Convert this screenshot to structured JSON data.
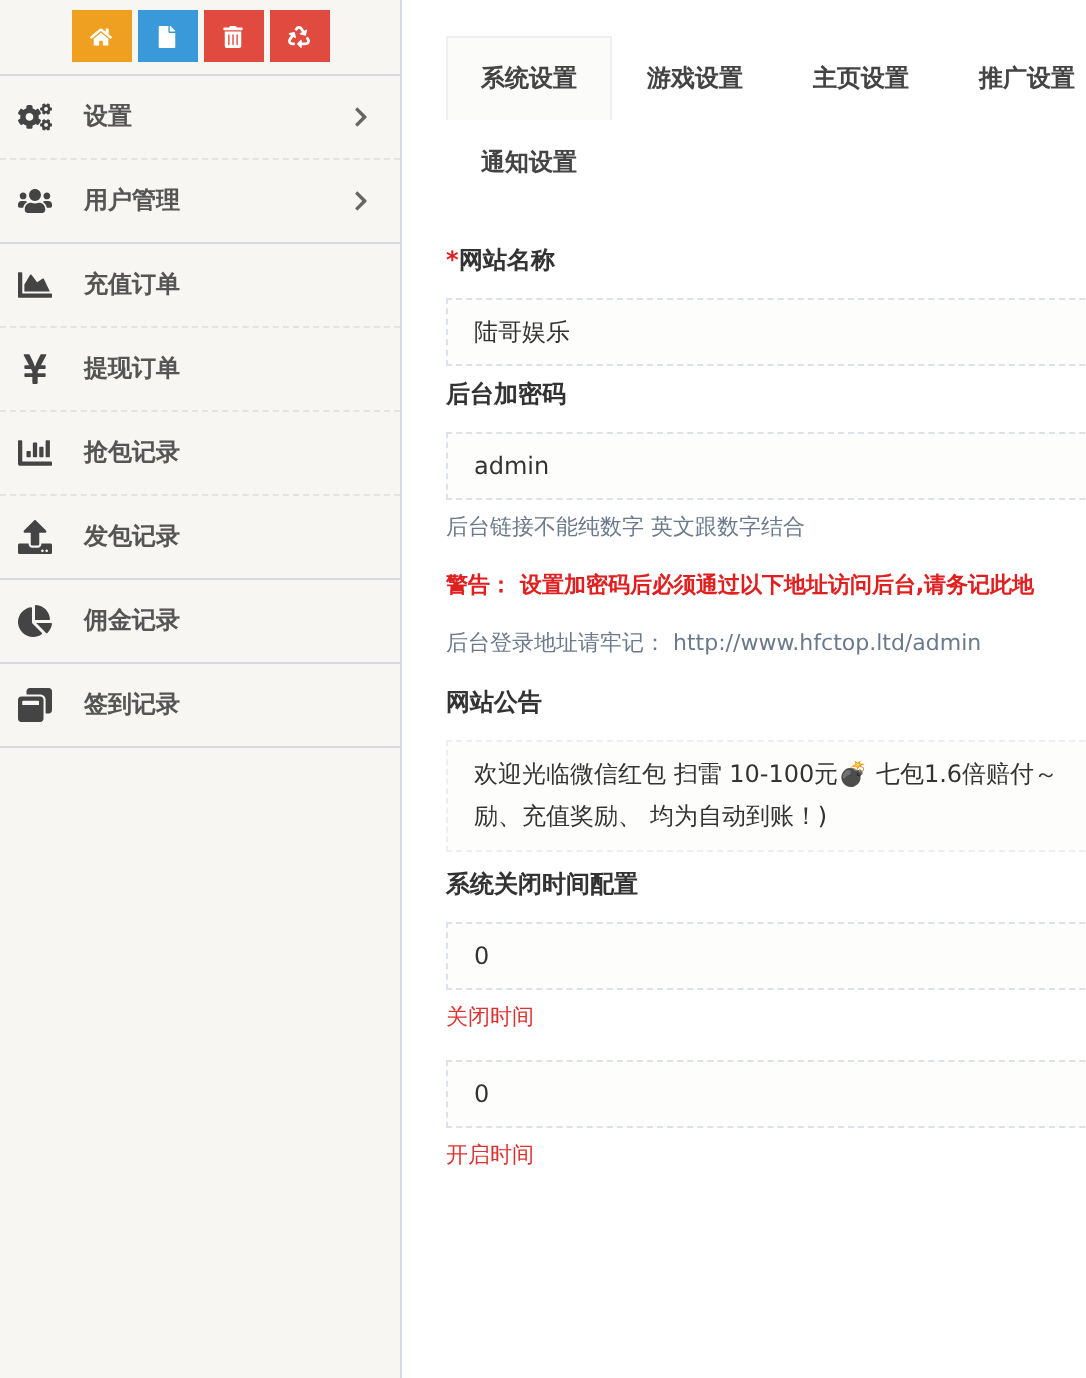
{
  "toolbar": [
    {
      "kind": "home",
      "color": "#f0a020"
    },
    {
      "kind": "file",
      "color": "#3a9ad9"
    },
    {
      "kind": "trash",
      "color": "#e04a3f"
    },
    {
      "kind": "recycle",
      "color": "#e04a3f"
    }
  ],
  "sidebar": {
    "items": [
      {
        "label": "设置",
        "expanded": false
      },
      {
        "label": "用户管理",
        "expanded": false
      },
      {
        "label": "充值订单"
      },
      {
        "label": "提现订单"
      },
      {
        "label": "抢包记录"
      },
      {
        "label": "发包记录"
      },
      {
        "label": "佣金记录"
      },
      {
        "label": "签到记录"
      }
    ]
  },
  "tabs": [
    {
      "label": "系统设置",
      "selected": true
    },
    {
      "label": "游戏设置",
      "selected": false
    },
    {
      "label": "主页设置",
      "selected": false
    },
    {
      "label": "推广设置",
      "selected": false
    },
    {
      "label": "通知设置",
      "selected": false
    }
  ],
  "form": [
    {
      "kind": "input",
      "label": "网站名称",
      "required_mark": "*",
      "value": "陆哥娱乐"
    },
    {
      "kind": "input",
      "label": "后台加密码",
      "value": "admin"
    },
    {
      "kind": "hint",
      "text": "后台链接不能纯数字 英文跟数字结合"
    },
    {
      "kind": "warning",
      "text": "警告： 设置加密码后必须通过以下地址访问后台,请务记此地"
    },
    {
      "kind": "hint",
      "text": "后台登录地址请牢记： http://www.hfctop.ltd/admin"
    },
    {
      "kind": "textarea",
      "label": "网站公告",
      "lines": [
        "欢迎光临微信红包 扫雷  10-100元💣 七包1.6倍赔付～",
        "励、充值奖励、 均为自动到账！)"
      ]
    },
    {
      "kind": "input",
      "label": "系统关闭时间配置",
      "value": "0"
    },
    {
      "kind": "note",
      "text": "关闭时间"
    },
    {
      "kind": "input",
      "value": "0"
    },
    {
      "kind": "note",
      "text": "开启时间"
    }
  ]
}
